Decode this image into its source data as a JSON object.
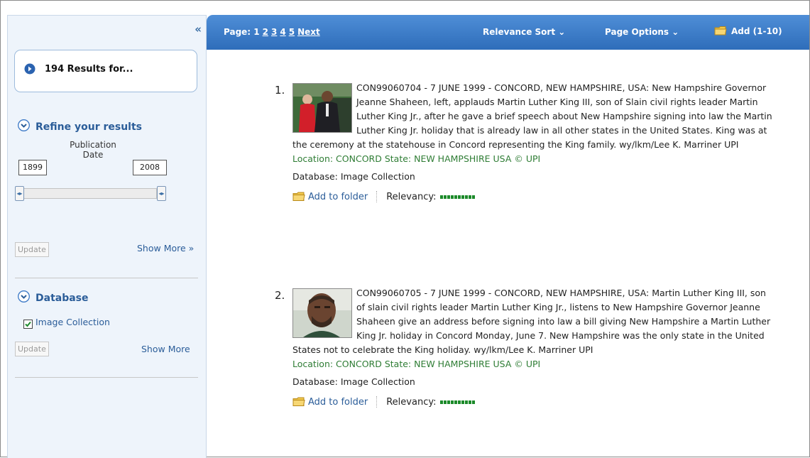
{
  "sidebar": {
    "collapse_glyph": "«",
    "results_count_label": "194 Results for...",
    "refine": {
      "title": "Refine your results",
      "pub_date_from": "1899",
      "pub_date_to": "2008",
      "pub_date_label_1": "Publication",
      "pub_date_label_2": "Date",
      "update_label": "Update",
      "show_more_label": "Show More »"
    },
    "database": {
      "title": "Database",
      "option_label": "Image Collection",
      "option_checked": true,
      "update_label": "Update",
      "show_more_label": "Show More"
    }
  },
  "topbar": {
    "page_label": "Page: 1",
    "pages": [
      "2",
      "3",
      "4",
      "5"
    ],
    "next_label": "Next",
    "sort_label": "Relevance Sort ⌄",
    "page_options_label": "Page Options ⌄",
    "add_label": "Add (1-10)"
  },
  "results": [
    {
      "number": "1.",
      "description": "CON99060704 - 7 JUNE 1999 - CONCORD, NEW HAMPSHIRE, USA: New Hampshire Governor Jeanne Shaheen, left, applauds Martin Luther King III, son of Slain civil rights leader Martin Luther King Jr., after he gave a brief speech about New Hampshire signing into law the Martin Luther King Jr. holiday that is already law in all other states in the United States. King was at the ceremony at the statehouse in Concord representing the King family. wy/lkm/Lee K. Marriner UPI",
      "location_line": "Location: CONCORD  State: NEW HAMPSHIRE USA © UPI",
      "database_line": "Database: Image Collection",
      "add_to_folder": "Add to folder",
      "relevancy_label": "Relevancy:",
      "relevancy": 1.0
    },
    {
      "number": "2.",
      "description": "CON99060705 - 7 JUNE 1999 - CONCORD, NEW HAMPSHIRE, USA: Martin Luther King III, son of slain civil rights leader Martin Luther King Jr., listens to New Hampshire Governor Jeanne Shaheen give an address before signing into law a bill giving New Hampshire a Martin Luther King Jr. holiday in Concord Monday, June 7. New Hampshire was the only state in the United States not to celebrate the King holiday. wy/lkm/Lee K. Marriner UPI",
      "location_line": "Location: CONCORD  State: NEW HAMPSHIRE USA © UPI",
      "database_line": "Database: Image Collection",
      "add_to_folder": "Add to folder",
      "relevancy_label": "Relevancy:",
      "relevancy": 1.0
    }
  ]
}
